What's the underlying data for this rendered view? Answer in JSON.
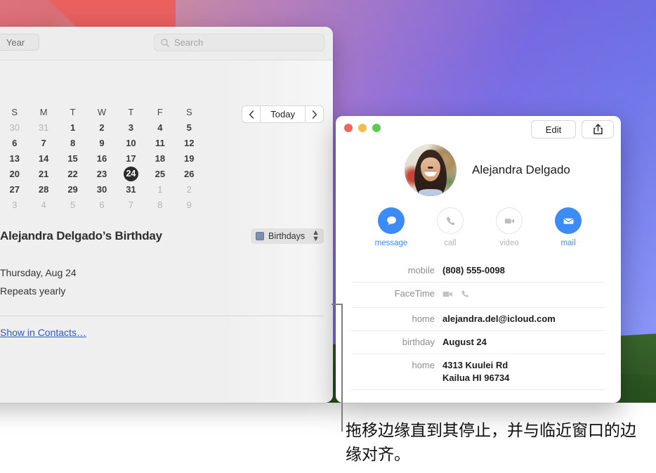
{
  "desktop": {
    "wallpaper_colors": {
      "red": "#e05758",
      "purple": "#a279d8",
      "blue": "#7b85f5",
      "green_hill": "#335c28"
    }
  },
  "calendar_window": {
    "toolbar": {
      "view_segment_label": "Year",
      "search_placeholder": "Search",
      "search_icon": "search-icon"
    },
    "mini_calendar": {
      "weekday_headers": [
        "S",
        "M",
        "T",
        "W",
        "T",
        "F",
        "S"
      ],
      "weeks": [
        [
          {
            "d": "30",
            "dim": true
          },
          {
            "d": "31",
            "dim": true
          },
          {
            "d": "1"
          },
          {
            "d": "2"
          },
          {
            "d": "3"
          },
          {
            "d": "4"
          },
          {
            "d": "5"
          }
        ],
        [
          {
            "d": "6"
          },
          {
            "d": "7"
          },
          {
            "d": "8"
          },
          {
            "d": "9"
          },
          {
            "d": "10"
          },
          {
            "d": "11"
          },
          {
            "d": "12"
          }
        ],
        [
          {
            "d": "13"
          },
          {
            "d": "14"
          },
          {
            "d": "15"
          },
          {
            "d": "16"
          },
          {
            "d": "17"
          },
          {
            "d": "18"
          },
          {
            "d": "19"
          }
        ],
        [
          {
            "d": "20"
          },
          {
            "d": "21"
          },
          {
            "d": "22"
          },
          {
            "d": "23"
          },
          {
            "d": "24",
            "today": true
          },
          {
            "d": "25"
          },
          {
            "d": "26"
          }
        ],
        [
          {
            "d": "27"
          },
          {
            "d": "28"
          },
          {
            "d": "29"
          },
          {
            "d": "30"
          },
          {
            "d": "31"
          },
          {
            "d": "1",
            "dim": true
          },
          {
            "d": "2",
            "dim": true
          }
        ],
        [
          {
            "d": "3",
            "dim": true
          },
          {
            "d": "4",
            "dim": true
          },
          {
            "d": "5",
            "dim": true
          },
          {
            "d": "6",
            "dim": true
          },
          {
            "d": "7",
            "dim": true
          },
          {
            "d": "8",
            "dim": true
          },
          {
            "d": "9",
            "dim": true
          }
        ]
      ]
    },
    "navigation": {
      "prev_label": "‹",
      "today_label": "Today",
      "next_label": "›"
    },
    "event": {
      "title": "Alejandra Delgado’s Birthday",
      "calendar_name": "Birthdays",
      "calendar_color": "#7b8fae",
      "date_line": "Thursday, Aug 24",
      "repeat_line": "Repeats yearly",
      "link_label": "Show in Contacts…"
    }
  },
  "contact_window": {
    "titlebar": {
      "edit_label": "Edit",
      "share_icon": "share-icon",
      "close_icon": "close-traffic-light",
      "minimize_icon": "minimize-traffic-light",
      "zoom_icon": "zoom-traffic-light"
    },
    "name": "Alejandra Delgado",
    "avatar_alt": "contact-photo",
    "quick_actions": [
      {
        "label": "message",
        "icon": "message-bubble-icon",
        "enabled": true
      },
      {
        "label": "call",
        "icon": "phone-icon",
        "enabled": false
      },
      {
        "label": "video",
        "icon": "video-camera-icon",
        "enabled": false
      },
      {
        "label": "mail",
        "icon": "envelope-icon",
        "enabled": true
      }
    ],
    "accent_color": "#3d8bf7",
    "fields": [
      {
        "label": "mobile",
        "value": "(808) 555-0098",
        "type": "text"
      },
      {
        "label": "FaceTime",
        "value": "",
        "type": "icons",
        "icons": [
          "video-camera-icon",
          "phone-icon"
        ]
      },
      {
        "label": "home",
        "value": "alejandra.del@icloud.com",
        "type": "text"
      },
      {
        "label": "birthday",
        "value": "August 24",
        "type": "text"
      },
      {
        "label": "home",
        "value": "4313 Kuulei Rd",
        "value2": "Kailua HI 96734",
        "type": "multiline"
      }
    ]
  },
  "callout": {
    "caption": "拖移边缘直到其停止，并与临近窗口的边缘对齐。"
  }
}
